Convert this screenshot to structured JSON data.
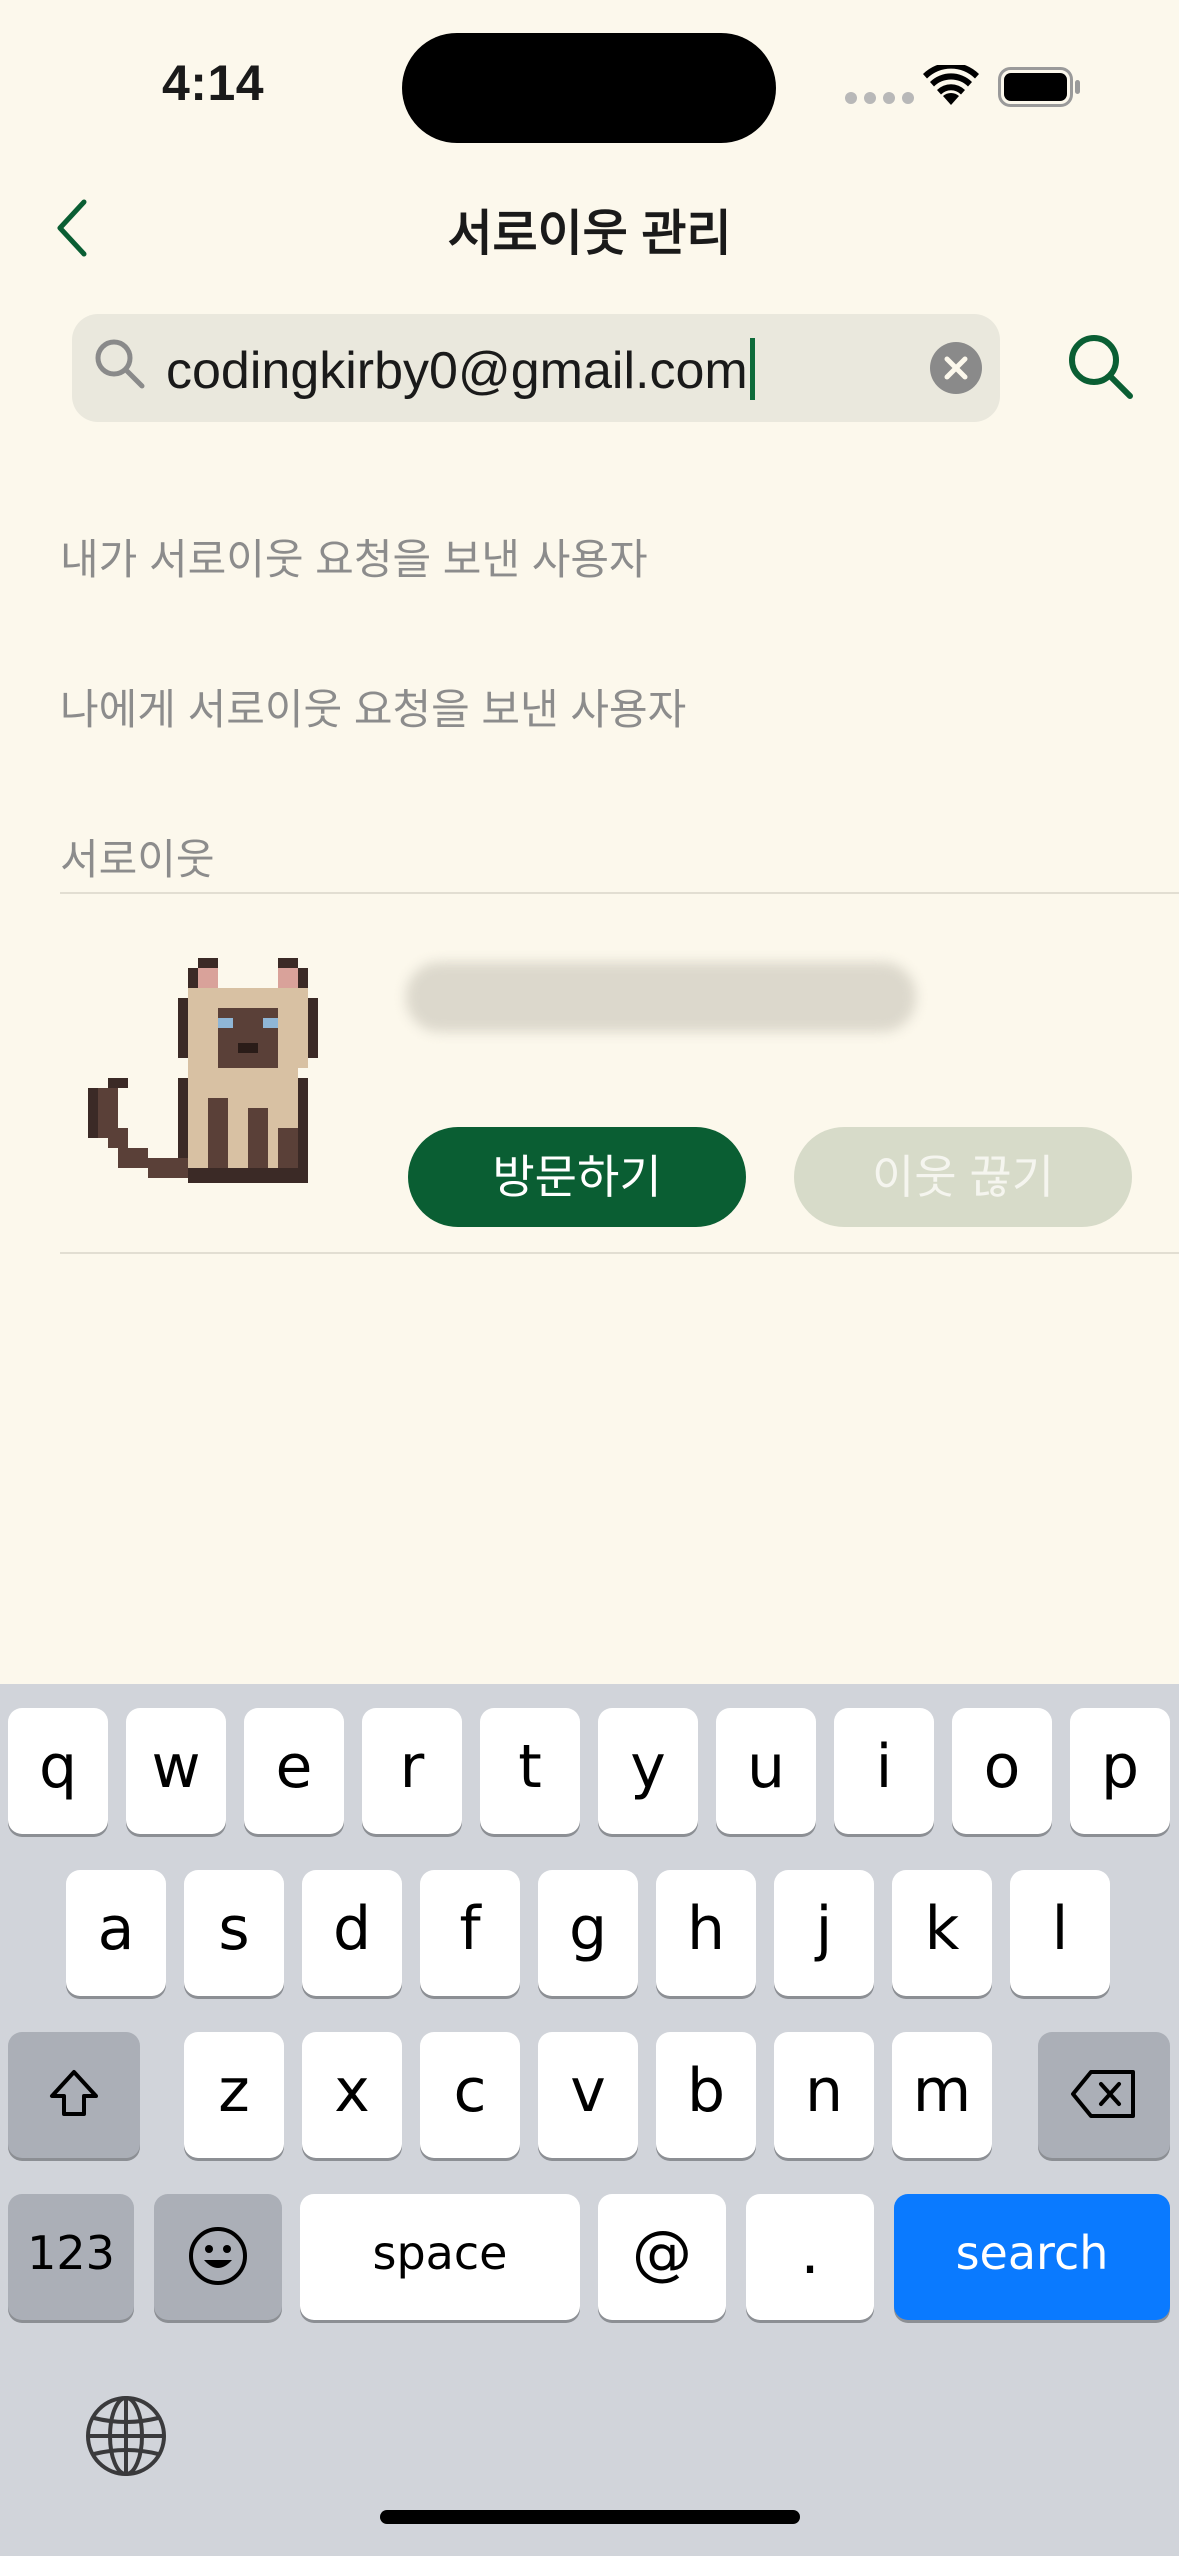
{
  "status_bar": {
    "time": "4:14"
  },
  "nav": {
    "title": "서로이웃 관리"
  },
  "search": {
    "value": "codingkirby0@gmail.com"
  },
  "sections": {
    "sent_requests": "내가 서로이웃 요청을 보낸 사용자",
    "received_requests": "나에게 서로이웃 요청을 보낸 사용자",
    "neighbors": "서로이웃"
  },
  "neighbor": {
    "visit_label": "방문하기",
    "unfollow_label": "이웃 끊기"
  },
  "keyboard": {
    "row1": [
      "q",
      "w",
      "e",
      "r",
      "t",
      "y",
      "u",
      "i",
      "o",
      "p"
    ],
    "row2": [
      "a",
      "s",
      "d",
      "f",
      "g",
      "h",
      "j",
      "k",
      "l"
    ],
    "row3": [
      "z",
      "x",
      "c",
      "v",
      "b",
      "n",
      "m"
    ],
    "numbers_label": "123",
    "space_label": "space",
    "at_label": "@",
    "period_label": ".",
    "search_label": "search"
  },
  "colors": {
    "background": "#fcf8ec",
    "accent": "#0a5e33",
    "keyboard_blue": "#0a7aff"
  }
}
